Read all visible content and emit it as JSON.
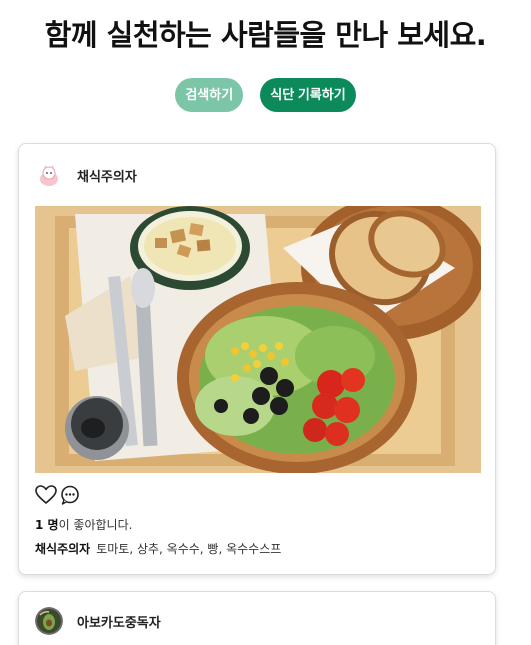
{
  "header": {
    "title": "함께 실천하는 사람들을 만나 보세요."
  },
  "actions": {
    "search_label": "검색하기",
    "log_label": "식단 기록하기"
  },
  "posts": [
    {
      "username": "채식주의자",
      "likes_count": "1 명",
      "likes_suffix": "이 좋아합니다.",
      "caption_author": "채식주의자",
      "caption_text": "토마토, 상추, 옥수수, 빵, 옥수수스프"
    },
    {
      "username": "아보카도중독자"
    }
  ],
  "colors": {
    "search_button": "#7cc5a6",
    "log_button": "#0c8a5a"
  },
  "icons": [
    "heart-icon",
    "comment-icon"
  ]
}
